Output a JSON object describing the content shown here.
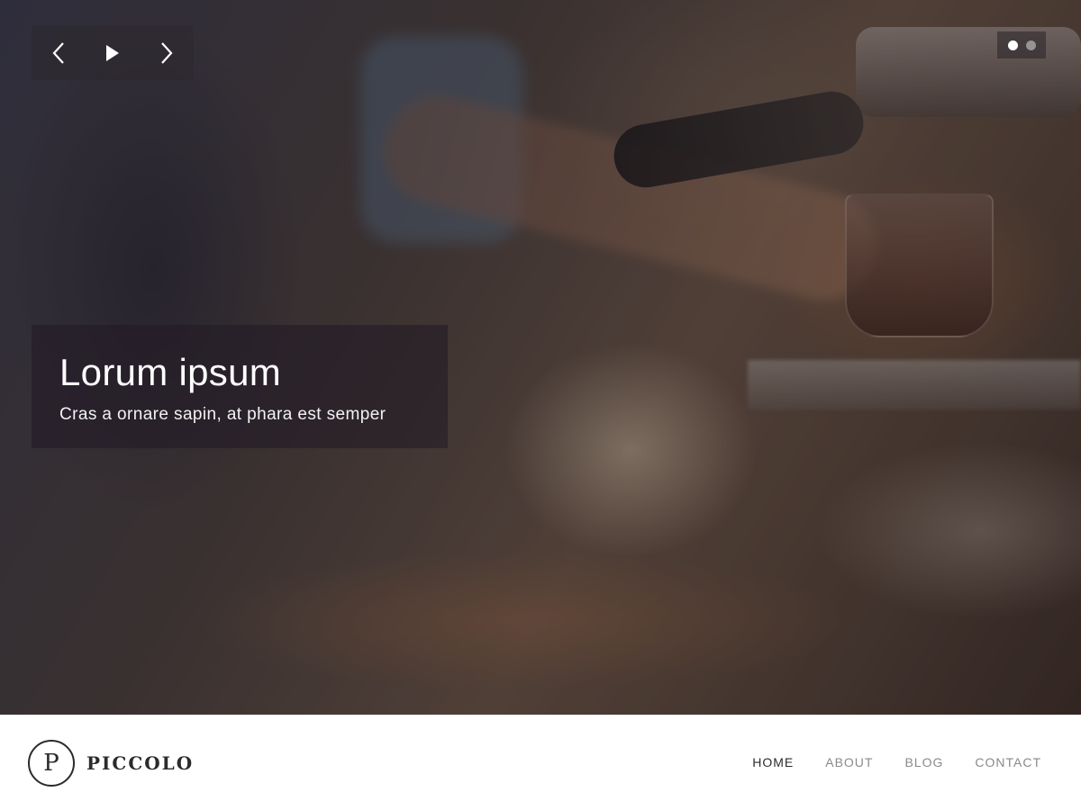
{
  "hero": {
    "caption_title": "Lorum ipsum",
    "caption_subtitle": "Cras a ornare sapin, at phara est semper",
    "controls": {
      "prev_icon": "chevron-left-icon",
      "play_icon": "play-icon",
      "next_icon": "chevron-right-icon"
    },
    "dots": {
      "count": 2,
      "active_index": 0
    }
  },
  "header": {
    "logo_letter": "P",
    "site_name": "PICCOLO",
    "nav": [
      {
        "label": "HOME",
        "current": true
      },
      {
        "label": "ABOUT",
        "current": false
      },
      {
        "label": "BLOG",
        "current": false
      },
      {
        "label": "CONTACT",
        "current": false
      }
    ]
  },
  "colors": {
    "text_dark": "#2b2b2b",
    "nav_muted": "#8a8a8a",
    "overlay": "#231c26"
  }
}
